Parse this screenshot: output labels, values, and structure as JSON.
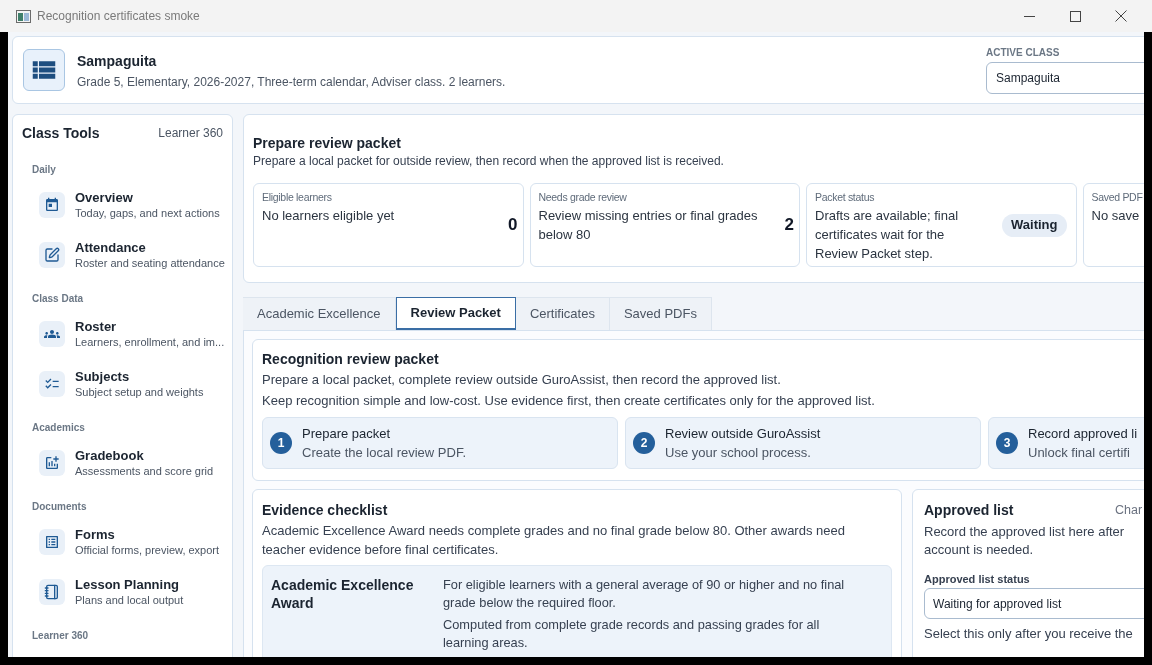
{
  "window": {
    "title": "Recognition certificates smoke"
  },
  "class_header": {
    "name": "Sampaguita",
    "details": "Grade 5, Elementary, 2026-2027, Three-term calendar, Adviser class. 2 learners.",
    "active_class_label": "ACTIVE CLASS",
    "active_class_value": "Sampaguita"
  },
  "sidebar": {
    "title": "Class Tools",
    "link": "Learner 360",
    "sections": [
      {
        "label": "Daily",
        "items": [
          {
            "title": "Overview",
            "subtitle": "Today, gaps, and next actions",
            "selected": false
          },
          {
            "title": "Attendance",
            "subtitle": "Roster and seating attendance",
            "selected": false
          }
        ]
      },
      {
        "label": "Class Data",
        "items": [
          {
            "title": "Roster",
            "subtitle": "Learners, enrollment, and im...",
            "selected": false
          },
          {
            "title": "Subjects",
            "subtitle": "Subject setup and weights",
            "selected": false
          }
        ]
      },
      {
        "label": "Academics",
        "items": [
          {
            "title": "Gradebook",
            "subtitle": "Assessments and score grid",
            "selected": false
          }
        ]
      },
      {
        "label": "Documents",
        "items": [
          {
            "title": "Forms",
            "subtitle": "Official forms, preview, export",
            "selected": false
          },
          {
            "title": "Lesson Planning",
            "subtitle": "Plans and local output",
            "selected": false
          }
        ]
      },
      {
        "label": "Learner 360"
      }
    ]
  },
  "packet_summary": {
    "title": "Prepare review packet",
    "description": "Prepare a local packet for outside review, then record when the approved list is received.",
    "stats": [
      {
        "kind": "count",
        "label": "Eligible learners",
        "text": "No learners eligible yet",
        "value": "0"
      },
      {
        "kind": "count",
        "label": "Needs grade review",
        "text": "Review missing entries or final grades below 80",
        "value": "2"
      },
      {
        "kind": "badge",
        "label": "Packet status",
        "text": "Drafts are available; final certificates wait for the Review Packet step.",
        "value": "Waiting"
      },
      {
        "kind": "plain",
        "label": "Saved PDF",
        "text": "No save"
      }
    ]
  },
  "tabs": [
    {
      "label": "Academic Excellence",
      "selected": false
    },
    {
      "label": "Review Packet",
      "selected": true
    },
    {
      "label": "Certificates",
      "selected": false
    },
    {
      "label": "Saved PDFs",
      "selected": false
    }
  ],
  "review_packet": {
    "title": "Recognition review packet",
    "lines": [
      "Prepare a local packet, complete review outside GuroAssist, then record the approved list.",
      "Keep recognition simple and low-cost. Use evidence first, then create certificates only for the approved list."
    ],
    "steps": [
      {
        "number": "1",
        "title": "Prepare packet",
        "text": "Create the local review PDF."
      },
      {
        "number": "2",
        "title": "Review outside GuroAssist",
        "text": "Use your school process."
      },
      {
        "number": "3",
        "title": "Record approved li",
        "text": "Unlock final certifi"
      }
    ]
  },
  "evidence_checklist": {
    "title": "Evidence checklist",
    "description": "Academic Excellence Award needs complete grades and no final grade below 80. Other awards need teacher evidence before final certificates.",
    "awards": [
      {
        "name": "Academic Excellence Award",
        "lines": [
          "For eligible learners with a general average of 90 or higher and no final grade below the required floor.",
          "Computed from complete grade records and passing grades for all learning areas."
        ]
      }
    ]
  },
  "approved_list": {
    "title": "Approved list",
    "action": "Char",
    "description_lines": [
      "Record the approved list here after",
      "account is needed."
    ],
    "status_field": {
      "label": "Approved list status",
      "value": "Waiting for approved list"
    },
    "note": "Select this only after you receive the"
  }
}
